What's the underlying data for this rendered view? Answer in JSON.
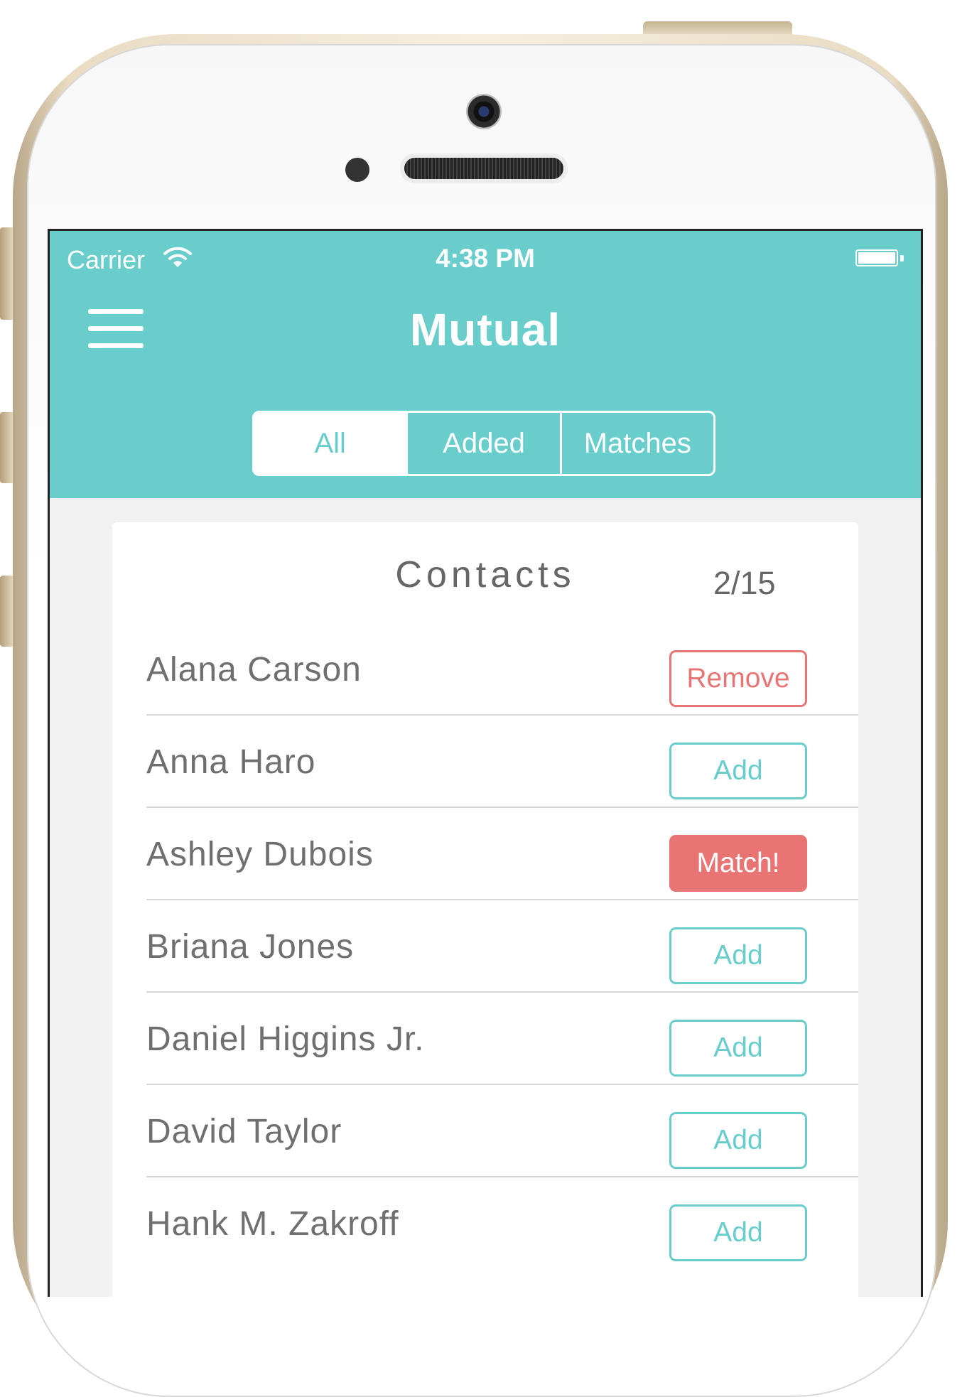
{
  "status_bar": {
    "carrier": "Carrier",
    "time": "4:38 PM"
  },
  "header": {
    "title": "Mutual"
  },
  "tabs": [
    {
      "label": "All",
      "active": true
    },
    {
      "label": "Added",
      "active": false
    },
    {
      "label": "Matches",
      "active": false
    }
  ],
  "contacts": {
    "title": "Contacts",
    "count": "2/15",
    "items": [
      {
        "name": "Alana Carson",
        "action": "Remove"
      },
      {
        "name": "Anna Haro",
        "action": "Add"
      },
      {
        "name": "Ashley Dubois",
        "action": "Match!"
      },
      {
        "name": "Briana Jones",
        "action": "Add"
      },
      {
        "name": "Daniel Higgins Jr.",
        "action": "Add"
      },
      {
        "name": "David Taylor",
        "action": "Add"
      },
      {
        "name": "Hank M. Zakroff",
        "action": "Add"
      }
    ]
  },
  "colors": {
    "accent": "#68cdcb",
    "alert": "#e87474",
    "text": "#6f6f6f"
  },
  "icons": [
    "wifi-icon",
    "battery-icon",
    "menu-icon",
    "camera-icon"
  ]
}
